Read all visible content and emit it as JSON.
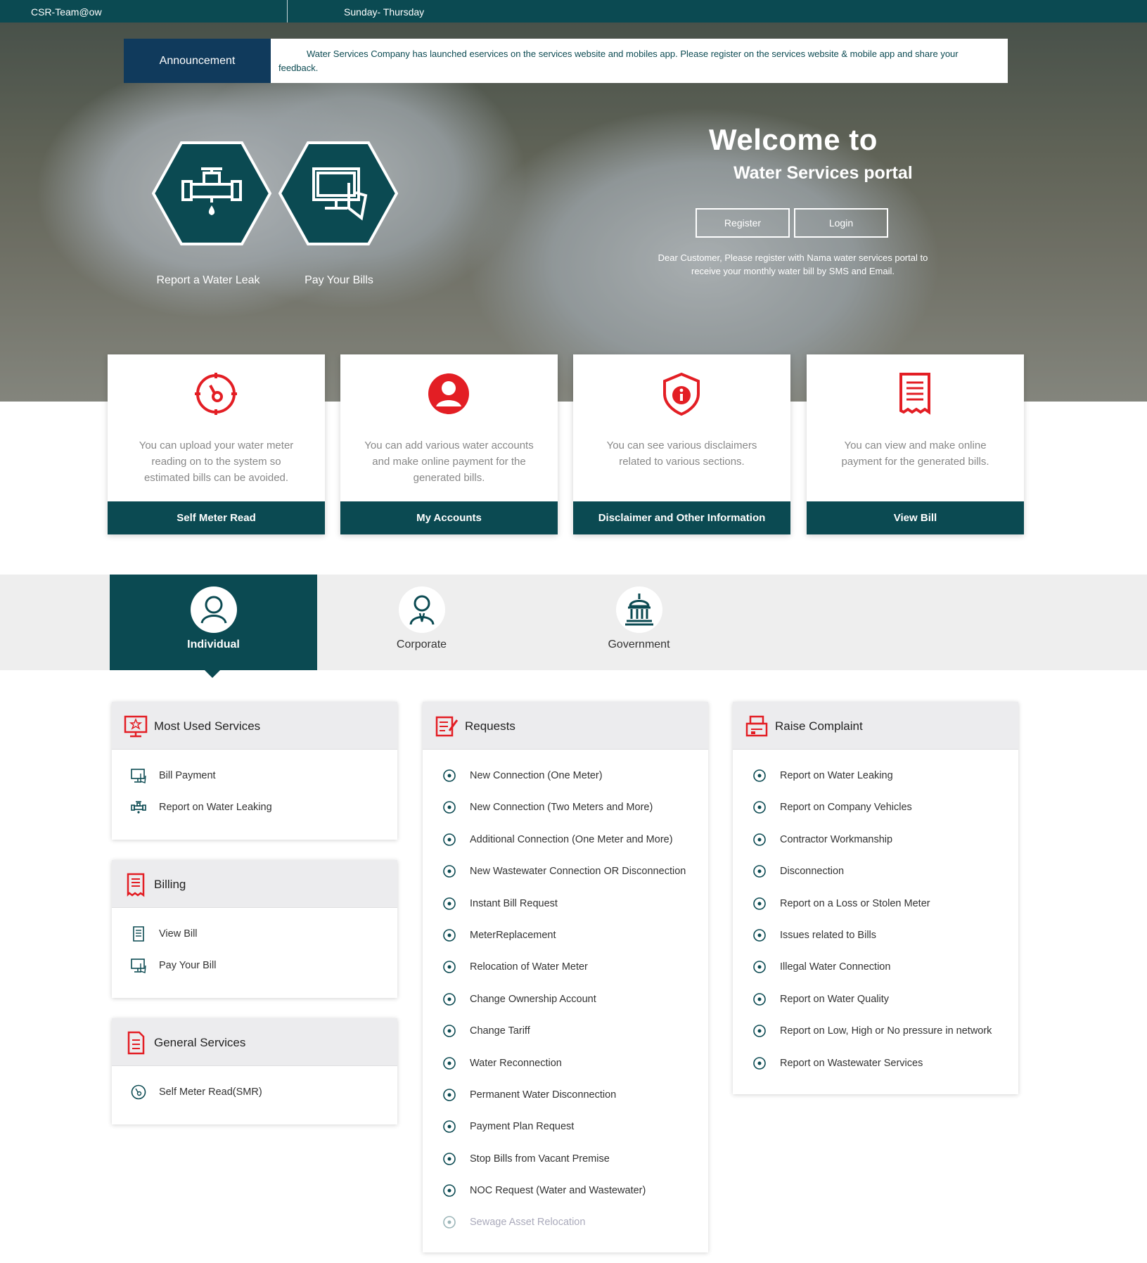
{
  "topbar": {
    "user": "CSR-Team@ow",
    "days": "Sunday- Thursday"
  },
  "announcement": {
    "label": "Announcement",
    "text": "Water Services Company has launched eservices on the services website and mobiles app. Please register on the services website &  mobile app and share your feedback."
  },
  "hero": {
    "quick_links": [
      {
        "label": "Report a Water Leak",
        "icon": "pipe-leak-icon"
      },
      {
        "label": "Pay Your Bills",
        "icon": "computer-payment-icon"
      }
    ],
    "welcome_line1": "Welcome to",
    "welcome_line2": "Water Services portal",
    "register_label": "Register",
    "login_label": "Login",
    "note": "Dear Customer, Please register with Nama water services portal to receive your monthly water bill by SMS and Email."
  },
  "cards": [
    {
      "icon": "meter-gauge-icon",
      "desc": "You can upload your water meter reading on to the system so estimated bills can be avoided.",
      "button": "Self Meter Read"
    },
    {
      "icon": "user-account-icon",
      "desc": "You can add various water accounts and make online payment for the generated bills.",
      "button": "My Accounts"
    },
    {
      "icon": "shield-info-icon",
      "desc": "You can see various disclaimers related to various sections.",
      "button": "Disclaimer and Other Information"
    },
    {
      "icon": "bill-receipt-icon",
      "desc": "You can view and make online payment for the generated bills.",
      "button": "View Bill"
    }
  ],
  "tabs": [
    {
      "label": "Individual",
      "icon": "person-icon",
      "active": true
    },
    {
      "label": "Corporate",
      "icon": "corporate-person-icon",
      "active": false
    },
    {
      "label": "Government",
      "icon": "government-building-icon",
      "active": false
    }
  ],
  "most_used": {
    "title": "Most Used Services",
    "items": [
      "Bill Payment",
      "Report on Water Leaking"
    ]
  },
  "billing": {
    "title": "Billing",
    "items": [
      "View Bill",
      "Pay Your Bill"
    ]
  },
  "general": {
    "title": "General Services",
    "items": [
      "Self Meter Read(SMR)"
    ]
  },
  "requests": {
    "title": "Requests",
    "items": [
      "New Connection (One Meter)",
      "New Connection (Two Meters and More)",
      "Additional Connection (One Meter and More)",
      "New Wastewater Connection OR Disconnection",
      "Instant Bill Request",
      "MeterReplacement",
      "Relocation of Water Meter",
      "Change Ownership Account",
      "Change Tariff",
      "Water Reconnection",
      "Permanent Water Disconnection",
      "Payment Plan Request",
      "Stop Bills from Vacant Premise",
      "NOC Request (Water and Wastewater)",
      "Sewage Asset Relocation"
    ]
  },
  "complaints": {
    "title": "Raise Complaint",
    "items": [
      "Report on Water Leaking",
      "Report on Company Vehicles",
      "Contractor Workmanship",
      "Disconnection",
      "Report on a Loss or Stolen Meter",
      "Issues related to Bills",
      "Illegal Water Connection",
      "Report on Water Quality",
      "Report on Low, High or No pressure in network",
      "Report on Wastewater Services"
    ]
  },
  "colors": {
    "primary": "#0b4a52",
    "accent": "#e31e24",
    "announce_label": "#103a5c"
  }
}
